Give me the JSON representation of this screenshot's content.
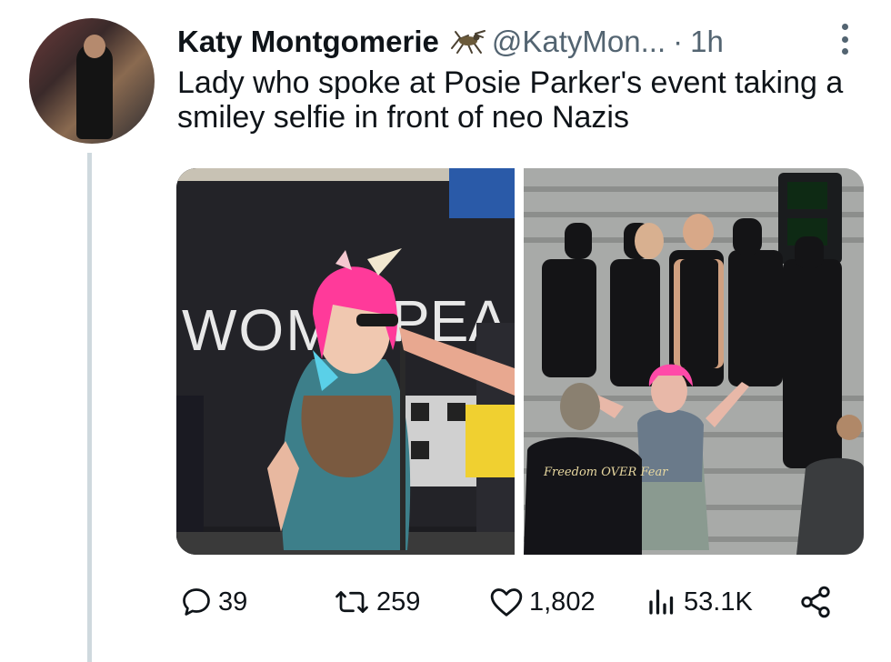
{
  "author": {
    "name": "Katy Montgomerie",
    "badge_icon": "cricket-icon",
    "handle": "@KatyMon...",
    "separator": "·",
    "time": "1h"
  },
  "tweet": {
    "text": "Lady who spoke at Posie Parker's event taking a smiley selfie in front of neo Nazis"
  },
  "media": {
    "left_banner_text_1": "WOM",
    "left_banner_text_2": "PEA",
    "right_shirt_text": "Freedom OVER Fear"
  },
  "actions": {
    "replies": "39",
    "reposts": "259",
    "likes": "1,802",
    "views": "53.1K"
  },
  "colors": {
    "text": "#0f1419",
    "secondary": "#536471",
    "thread_line": "#cfd9de"
  }
}
